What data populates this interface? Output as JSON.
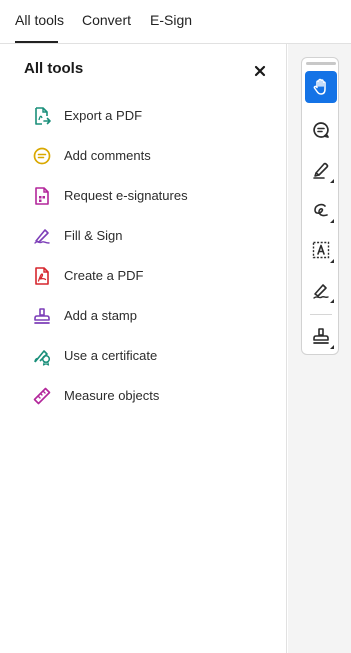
{
  "tabs": [
    {
      "label": "All tools",
      "active": true
    },
    {
      "label": "Convert",
      "active": false
    },
    {
      "label": "E-Sign",
      "active": false
    }
  ],
  "panel": {
    "title": "All tools",
    "close_icon": "close-icon",
    "tools": [
      {
        "label": "Export a PDF",
        "icon": "export-pdf-icon",
        "color": "#1a8f7a"
      },
      {
        "label": "Add comments",
        "icon": "comment-icon",
        "color": "#d9a800"
      },
      {
        "label": "Request e-signatures",
        "icon": "request-signature-icon",
        "color": "#b3279b"
      },
      {
        "label": "Fill & Sign",
        "icon": "fill-sign-icon",
        "color": "#7d3fb8"
      },
      {
        "label": "Create a PDF",
        "icon": "create-pdf-icon",
        "color": "#d6272e"
      },
      {
        "label": "Add a stamp",
        "icon": "stamp-icon",
        "color": "#7d3fb8"
      },
      {
        "label": "Use a certificate",
        "icon": "certificate-icon",
        "color": "#1a8f7a"
      },
      {
        "label": "Measure objects",
        "icon": "ruler-icon",
        "color": "#b3279b"
      }
    ]
  },
  "rail": {
    "tools": [
      {
        "name": "hand-tool",
        "icon": "hand-icon",
        "active": true
      },
      {
        "name": "comment-tool",
        "icon": "comment-icon",
        "active": false
      },
      {
        "name": "highlight-tool",
        "icon": "pen-icon",
        "active": false
      },
      {
        "name": "draw-tool",
        "icon": "freehand-icon",
        "active": false
      },
      {
        "name": "text-tool",
        "icon": "text-box-icon",
        "active": false
      },
      {
        "name": "sign-tool",
        "icon": "signature-icon",
        "active": false
      },
      {
        "name": "stamp-tool",
        "icon": "stamp-icon",
        "active": false
      }
    ],
    "active_color": "#1473e6"
  }
}
